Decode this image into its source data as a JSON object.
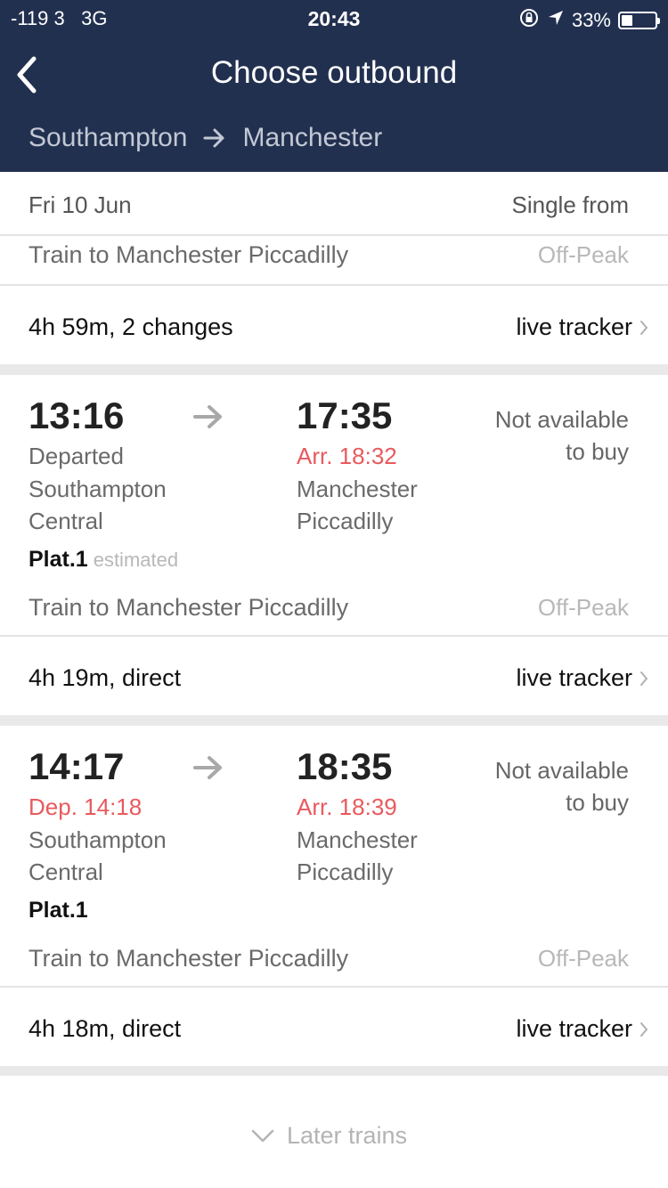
{
  "status_bar": {
    "signal": "-119 3",
    "network": "3G",
    "time": "20:43",
    "battery": "33%",
    "battery_level": 0.33
  },
  "header": {
    "title": "Choose outbound",
    "origin": "Southampton",
    "destination": "Manchester"
  },
  "summary": {
    "date": "Fri 10 Jun",
    "price_label": "Single from"
  },
  "partial_result": {
    "train_to": "Train to Manchester Piccadilly",
    "fare_type": "Off-Peak",
    "duration": "4h 59m, 2 changes",
    "tracker": "live tracker"
  },
  "journeys": [
    {
      "departure_time": "13:16",
      "departure_status": "Departed",
      "departure_station_line1": "Southampton",
      "departure_station_line2": "Central",
      "arrival_time": "17:35",
      "arrival_status": "Arr. 18:32",
      "arrival_station_line1": "Manchester",
      "arrival_station_line2": "Piccadilly",
      "availability_line1": "Not available",
      "availability_line2": "to buy",
      "platform": "Plat.1",
      "platform_note": "estimated",
      "train_to": "Train to Manchester Piccadilly",
      "fare_type": "Off-Peak",
      "duration": "4h 19m, direct",
      "tracker": "live tracker"
    },
    {
      "departure_time": "14:17",
      "departure_status": "Dep. 14:18",
      "departure_station_line1": "Southampton",
      "departure_station_line2": "Central",
      "arrival_time": "18:35",
      "arrival_status": "Arr. 18:39",
      "arrival_station_line1": "Manchester",
      "arrival_station_line2": "Piccadilly",
      "availability_line1": "Not available",
      "availability_line2": "to buy",
      "platform": "Plat.1",
      "platform_note": "",
      "train_to": "Train to Manchester Piccadilly",
      "fare_type": "Off-Peak",
      "duration": "4h 18m, direct",
      "tracker": "live tracker"
    }
  ],
  "later_trains": "Later trains",
  "colors": {
    "header_bg": "#223050",
    "delay_red": "#e85a5e",
    "separator": "#e9e9e9"
  }
}
